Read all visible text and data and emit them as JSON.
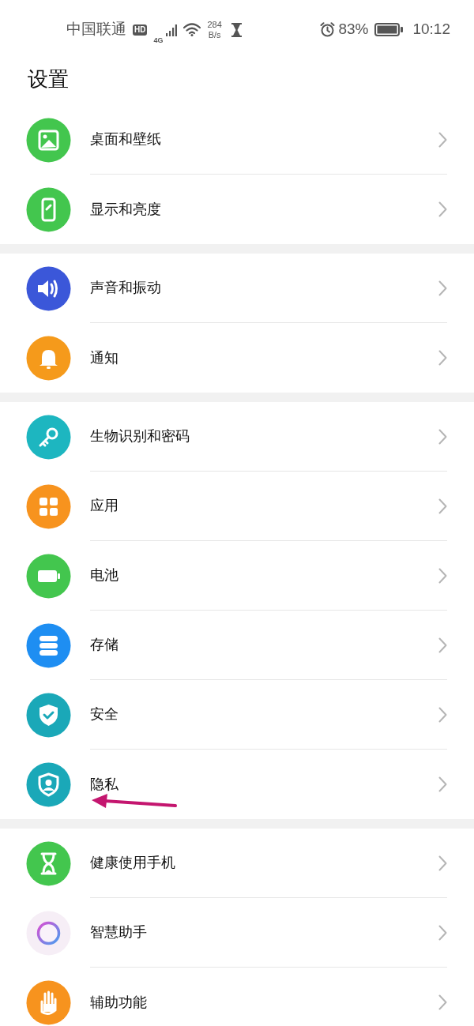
{
  "status_bar": {
    "carrier": "中国联通",
    "hd_badge": "HD",
    "network": "4G",
    "speed_value": "284",
    "speed_unit": "B/s",
    "battery_percent": "83%",
    "time": "10:12"
  },
  "title": "设置",
  "groups": [
    {
      "items": [
        {
          "label": "桌面和壁纸",
          "kind": "wallpaper"
        },
        {
          "label": "显示和亮度",
          "kind": "display"
        }
      ]
    },
    {
      "items": [
        {
          "label": "声音和振动",
          "kind": "sound"
        },
        {
          "label": "通知",
          "kind": "notification"
        }
      ]
    },
    {
      "items": [
        {
          "label": "生物识别和密码",
          "kind": "biometrics"
        },
        {
          "label": "应用",
          "kind": "apps"
        },
        {
          "label": "电池",
          "kind": "battery"
        },
        {
          "label": "存储",
          "kind": "storage"
        },
        {
          "label": "安全",
          "kind": "security"
        },
        {
          "label": "隐私",
          "kind": "privacy"
        }
      ]
    },
    {
      "items": [
        {
          "label": "健康使用手机",
          "kind": "digital_balance"
        },
        {
          "label": "智慧助手",
          "kind": "assistant"
        },
        {
          "label": "辅助功能",
          "kind": "accessibility"
        }
      ]
    }
  ],
  "annotation": {
    "kind": "arrow"
  }
}
